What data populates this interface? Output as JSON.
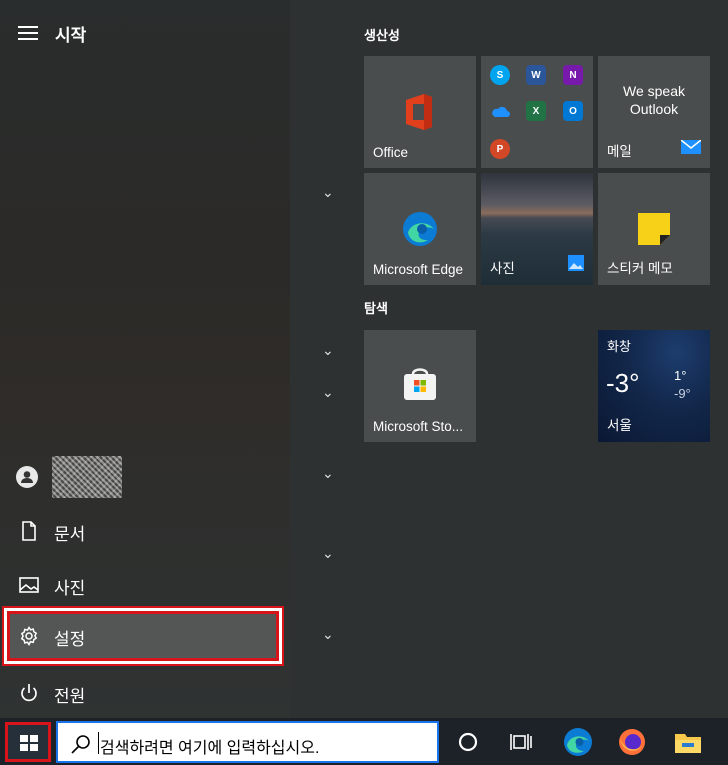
{
  "start_menu": {
    "title": "시작",
    "user": {
      "name_obscured": ""
    },
    "rail_items": [
      {
        "label": "문서",
        "icon": "document-icon"
      },
      {
        "label": "사진",
        "icon": "photos-icon"
      },
      {
        "label": "설정",
        "icon": "gear-icon"
      },
      {
        "label": "전원",
        "icon": "power-icon"
      }
    ]
  },
  "groups": [
    {
      "title": "생산성"
    },
    {
      "title": "탐색"
    }
  ],
  "tiles": {
    "office": "Office",
    "mail_text": "We speak Outlook",
    "mail": "메일",
    "edge": "Microsoft Edge",
    "photos": "사진",
    "sticky": "스티커 메모",
    "store": "Microsoft Sto...",
    "weather": {
      "condition": "화창",
      "temp": "-3°",
      "high": "1°",
      "low": "-9°",
      "city": "서울"
    }
  },
  "taskbar": {
    "search_placeholder": "검색하려면 여기에 입력하십시오."
  },
  "colors": {
    "highlight_border": "#d8141b",
    "search_border": "#1a73e8",
    "tile_bg": "#4a4d4d"
  }
}
